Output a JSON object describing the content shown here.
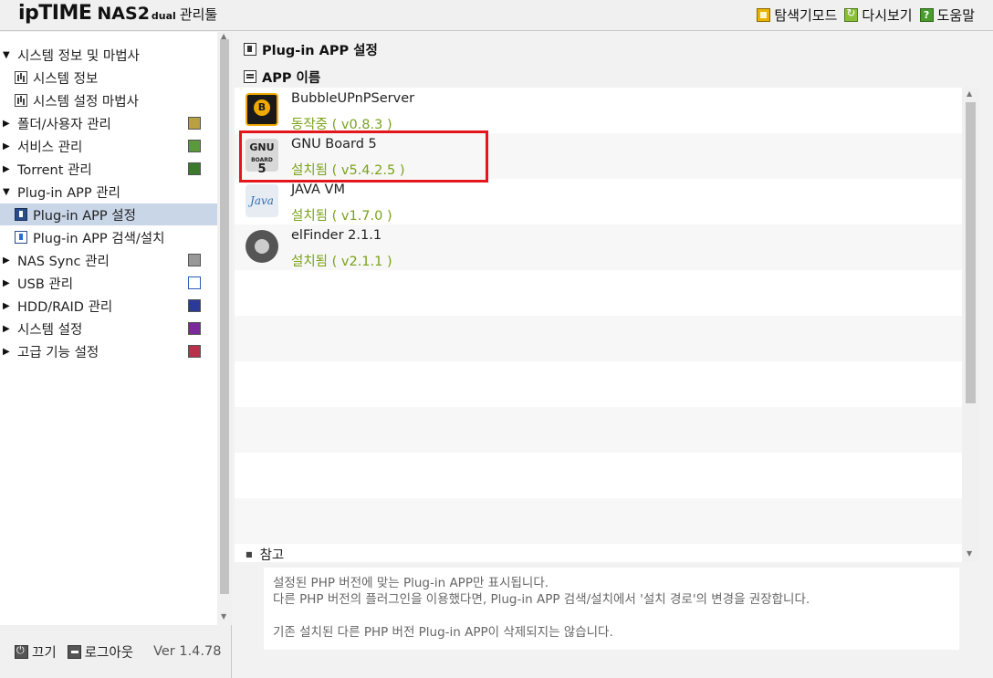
{
  "topbar": {
    "logo_iptime": "ipTIME",
    "logo_nas": "NAS2",
    "logo_dual": "dual",
    "logo_tool": "관리툴",
    "menu": [
      {
        "label": "탐색기모드",
        "icon": "explorer-mode-icon"
      },
      {
        "label": "다시보기",
        "icon": "refresh-icon"
      },
      {
        "label": "도움말",
        "icon": "help-icon"
      }
    ]
  },
  "sidebar": {
    "items": [
      {
        "label": "시스템 정보 및 마법사",
        "expanded": true
      },
      {
        "label": "시스템 정보",
        "sub": true
      },
      {
        "label": "시스템 설정 마법사",
        "sub": true
      },
      {
        "label": "폴더/사용자 관리",
        "expanded": false
      },
      {
        "label": "서비스 관리",
        "expanded": false
      },
      {
        "label": "Torrent 관리",
        "expanded": false
      },
      {
        "label": "Plug-in APP 관리",
        "expanded": true
      },
      {
        "label": "Plug-in APP 설정",
        "sub": true,
        "active": true
      },
      {
        "label": "Plug-in APP 검색/설치",
        "sub": true
      },
      {
        "label": "NAS Sync 관리",
        "expanded": false
      },
      {
        "label": "USB 관리",
        "expanded": false
      },
      {
        "label": "HDD/RAID 관리",
        "expanded": false
      },
      {
        "label": "시스템 설정",
        "expanded": false
      },
      {
        "label": "고급 기능 설정",
        "expanded": false
      }
    ],
    "footer": {
      "power_label": "끄기",
      "logout_label": "로그아웃",
      "version": "Ver 1.4.78"
    }
  },
  "main": {
    "section_title": "Plug-in APP 설정",
    "list_title": "APP 이름",
    "apps": [
      {
        "name": "BubbleUPnPServer",
        "status": "동작중 ( v0.8.3 )",
        "icon": "bubbleupnp-icon"
      },
      {
        "name": "GNU Board 5",
        "status": "설치됨 ( v5.4.2.5 )",
        "icon": "gnuboard-icon",
        "highlighted": true
      },
      {
        "name": "JAVA VM",
        "status": "설치됨 ( v1.7.0 )",
        "icon": "java-icon"
      },
      {
        "name": "elFinder 2.1.1",
        "status": "설치됨 ( v2.1.1 )",
        "icon": "elfinder-icon"
      }
    ],
    "gnu_icon_top": "GNU",
    "gnu_icon_board": "BOARD",
    "gnu_icon_num": "5",
    "java_icon_text": "Java",
    "note": {
      "title": "참고",
      "line1": "설정된 PHP 버전에 맞는 Plug-in APP만 표시됩니다.",
      "line2": "다른 PHP 버전의 플러그인을 이용했다면, Plug-in APP 검색/설치에서 '설치 경로'의 변경을 권장합니다.",
      "line3": "기존 설치된 다른 PHP 버전 Plug-in APP이 삭제되지는 않습니다."
    }
  },
  "colors": {
    "status_green": "#7aa21a",
    "highlight_red": "#e3161b",
    "active_bg": "#c9d6e8"
  }
}
